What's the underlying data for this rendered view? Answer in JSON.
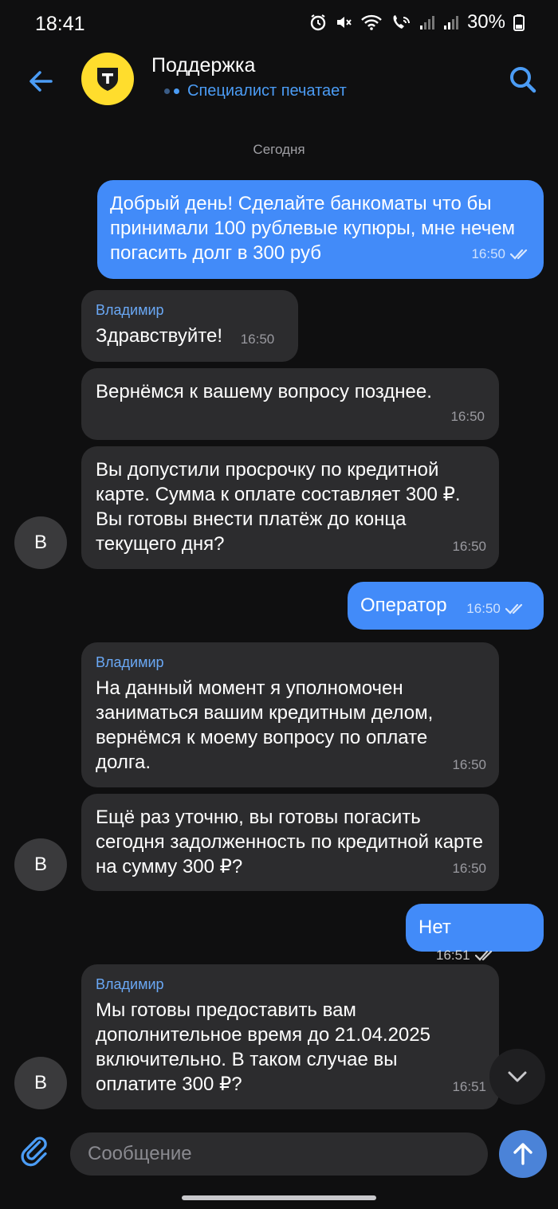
{
  "status_bar": {
    "time": "18:41",
    "battery": "30%",
    "icons": [
      "alarm-icon",
      "mute-icon",
      "wifi-icon",
      "wifi-call-icon",
      "signal-icon",
      "signal-icon",
      "battery-icon"
    ]
  },
  "header": {
    "title": "Поддержка",
    "status": "Специалист печатает",
    "back_icon": "arrow-left-icon",
    "search_icon": "search-icon",
    "avatar_icon": "tinkoff-shield-logo",
    "accent_color": "#4b9cf5"
  },
  "date_divider": "Сегодня",
  "messages": [
    {
      "direction": "out",
      "text": "Добрый день! Сделайте банкоматы что бы принимали 100 рублевые купюры, мне нечем погасить долг в 300 руб",
      "time": "16:50",
      "read": true
    },
    {
      "direction": "in",
      "sender": "Владимир",
      "text": "Здравствуйте!",
      "time": "16:50"
    },
    {
      "direction": "in",
      "text": "Вернёмся к вашему вопросу позднее.",
      "time": "16:50"
    },
    {
      "direction": "in",
      "text": "Вы допустили просрочку по кредитной карте. Сумма к оплате составляет 300 ₽. Вы готовы внести платёж до конца текущего дня?",
      "time": "16:50",
      "avatar": "В"
    },
    {
      "direction": "out",
      "text": "Оператор",
      "time": "16:50",
      "read": true
    },
    {
      "direction": "in",
      "sender": "Владимир",
      "text": "На данный момент я уполномочен заниматься вашим кредитным делом, вернёмся к моему вопросу по оплате долга.",
      "time": "16:50"
    },
    {
      "direction": "in",
      "text": "Ещё раз уточню, вы готовы погасить сегодня задолженность по кредитной карте на сумму 300 ₽?",
      "time": "16:50",
      "avatar": "В"
    },
    {
      "direction": "out",
      "text": "Нет",
      "time": "16:51",
      "read": true
    },
    {
      "direction": "in",
      "sender": "Владимир",
      "text": "Мы готовы предоставить вам дополнительное время до 21.04.2025 включительно. В таком случае вы оплатите 300 ₽?",
      "time": "16:51",
      "avatar": "В"
    }
  ],
  "composer": {
    "placeholder": "Сообщение",
    "attach_icon": "paperclip-icon",
    "send_icon": "arrow-up-icon"
  },
  "colors": {
    "background": "#0f0f10",
    "outgoing_bubble": "#428bf9",
    "incoming_bubble": "#2c2c2e",
    "sender_name": "#6aa8f5"
  }
}
